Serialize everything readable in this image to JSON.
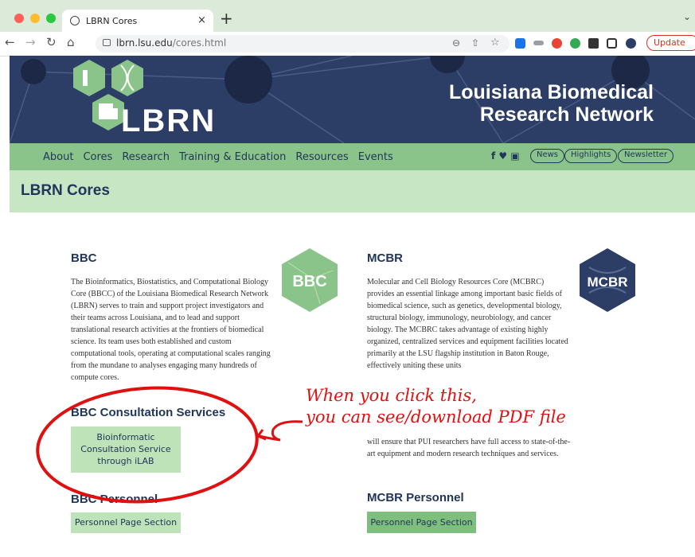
{
  "browser": {
    "tab_title": "LBRN Cores",
    "tab_close": "×",
    "new_tab": "+",
    "url_host": "lbrn.lsu.edu",
    "url_path": "/cores.html",
    "update_label": "Update"
  },
  "hero": {
    "logo_text": "LBRN",
    "title_line1": "Louisiana Biomedical",
    "title_line2": "Research Network"
  },
  "nav": {
    "links": [
      "About",
      "Cores",
      "Research",
      "Training & Education",
      "Resources",
      "Events"
    ],
    "pills": [
      "News",
      "Highlights",
      "Newsletter"
    ]
  },
  "page_title": "LBRN Cores",
  "bbc": {
    "heading": "BBC",
    "badge": "BBC",
    "description": "The Bioinformatics, Biostatistics, and Computational Biology Core (BBCC) of the Louisiana Biomedical Research Network (LBRN) serves to train and support project investigators and their teams across Louisiana, and to lead and support translational research activities at the frontiers of biomedical science. Its team uses both established and custom computational tools, operating at computational scales ranging from the mundane to analyses engaging many hundreds of compute cores.",
    "consult_heading": "BBC Consultation Services",
    "consult_button": "Bioinformatic Consultation Service through iLAB",
    "personnel_heading": "BBC Personnel",
    "personnel_button": "Personnel Page Section"
  },
  "mcbr": {
    "heading": "MCBR",
    "badge": "MCBR",
    "description_top": "Molecular and Cell Biology Resources Core (MCBRC) provides an essential linkage among important basic fields of biomedical science, such as genetics, developmental biology, structural biology, immunology, neurobiology, and cancer biology. The MCBRC takes advantage of existing highly organized, centralized services and equipment facilities located primarily at the LSU flagship institution in Baton Rouge, effectively uniting these units",
    "description_bottom": "will ensure that PUI researchers have full access to state-of-the-art equipment and modern research techniques and services.",
    "personnel_heading": "MCBR Personnel",
    "personnel_button": "Personnel Page Section"
  },
  "annotation": {
    "line1": "When you click this,",
    "line2": "you can see/download PDF file",
    "color": "#e01010"
  }
}
